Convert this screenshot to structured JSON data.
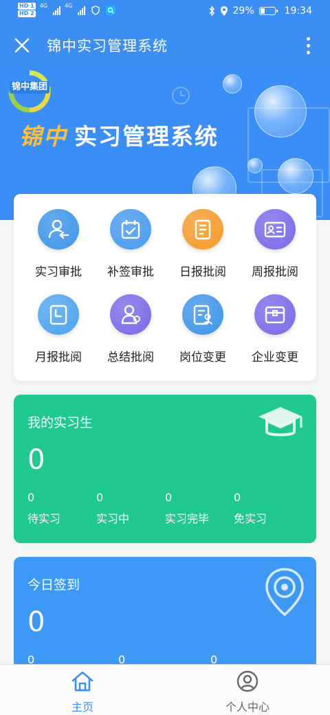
{
  "status_bar": {
    "sim1": "HD 1",
    "sim2": "HD 2",
    "network1": "4G",
    "network2": "4G",
    "battery_percent": "29%",
    "battery_level": 0.29,
    "time": "19:34"
  },
  "titlebar": {
    "title": "锦中实习管理系统",
    "close_icon": "close-icon",
    "more_icon": "more-vertical-icon"
  },
  "banner": {
    "logo_text": "锦中集团",
    "brand": "锦中",
    "title": "实习管理系统"
  },
  "menu": {
    "items": [
      {
        "label": "实习审批",
        "icon": "user-return-icon",
        "color": "#3f95e8"
      },
      {
        "label": "补签审批",
        "icon": "calendar-check-icon",
        "color": "#4a9af0"
      },
      {
        "label": "日报批阅",
        "icon": "document-list-icon",
        "color": "#f59b2a"
      },
      {
        "label": "周报批阅",
        "icon": "id-card-icon",
        "color": "#7a6ae8"
      },
      {
        "label": "月报批阅",
        "icon": "calendar-clock-icon",
        "color": "#4ea3ee"
      },
      {
        "label": "总结批阅",
        "icon": "user-summary-icon",
        "color": "#7a6ae8"
      },
      {
        "label": "岗位变更",
        "icon": "document-user-icon",
        "color": "#3f95e8"
      },
      {
        "label": "企业变更",
        "icon": "box-icon",
        "color": "#7a6ae8"
      }
    ]
  },
  "my_interns": {
    "title": "我的实习生",
    "total": "0",
    "stats": [
      {
        "value": "0",
        "label": "待实习"
      },
      {
        "value": "0",
        "label": "实习中"
      },
      {
        "value": "0",
        "label": "实习完毕"
      },
      {
        "value": "0",
        "label": "免实习"
      }
    ],
    "color": "#1fc98e"
  },
  "today_signin": {
    "title": "今日签到",
    "total": "0",
    "stats": [
      {
        "value": "0"
      },
      {
        "value": "0"
      },
      {
        "value": "0"
      }
    ],
    "color": "#3d99f5"
  },
  "bottom_nav": {
    "items": [
      {
        "label": "主页",
        "icon": "home-icon",
        "active": true
      },
      {
        "label": "个人中心",
        "icon": "profile-icon",
        "active": false
      }
    ],
    "active_color": "#3c8ef2",
    "inactive_color": "#666666"
  }
}
